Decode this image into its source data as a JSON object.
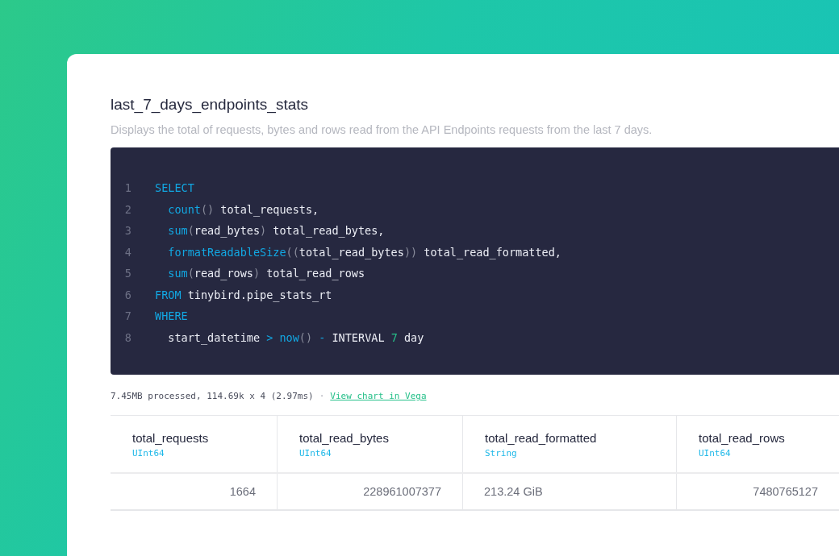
{
  "title": "last_7_days_endpoints_stats",
  "description": "Displays the total of requests, bytes and rows read from the API Endpoints requests from the last 7 days.",
  "code": [
    {
      "number": "1",
      "tokens": [
        {
          "text": "SELECT",
          "kind": "keyword"
        }
      ]
    },
    {
      "number": "2",
      "tokens": [
        {
          "text": "  count",
          "kind": "keyword"
        },
        {
          "text": "()",
          "kind": "punct"
        },
        {
          "text": " total_requests,",
          "kind": "plain"
        }
      ]
    },
    {
      "number": "3",
      "tokens": [
        {
          "text": "  sum",
          "kind": "keyword"
        },
        {
          "text": "(",
          "kind": "punct"
        },
        {
          "text": "read_bytes",
          "kind": "plain"
        },
        {
          "text": ")",
          "kind": "punct"
        },
        {
          "text": " total_read_bytes,",
          "kind": "plain"
        }
      ]
    },
    {
      "number": "4",
      "tokens": [
        {
          "text": "  formatReadableSize",
          "kind": "keyword"
        },
        {
          "text": "((",
          "kind": "punct"
        },
        {
          "text": "total_read_bytes",
          "kind": "plain"
        },
        {
          "text": "))",
          "kind": "punct"
        },
        {
          "text": " total_read_formatted,",
          "kind": "plain"
        }
      ]
    },
    {
      "number": "5",
      "tokens": [
        {
          "text": "  sum",
          "kind": "keyword"
        },
        {
          "text": "(",
          "kind": "punct"
        },
        {
          "text": "read_rows",
          "kind": "plain"
        },
        {
          "text": ")",
          "kind": "punct"
        },
        {
          "text": " total_read_rows",
          "kind": "plain"
        }
      ]
    },
    {
      "number": "6",
      "tokens": [
        {
          "text": "FROM",
          "kind": "keyword"
        },
        {
          "text": " tinybird.pipe_stats_rt",
          "kind": "plain"
        }
      ]
    },
    {
      "number": "7",
      "tokens": [
        {
          "text": "WHERE",
          "kind": "keyword"
        }
      ]
    },
    {
      "number": "8",
      "tokens": [
        {
          "text": "  start_datetime ",
          "kind": "plain"
        },
        {
          "text": ">",
          "kind": "keyword"
        },
        {
          "text": " now",
          "kind": "keyword"
        },
        {
          "text": "()",
          "kind": "punct"
        },
        {
          "text": " -",
          "kind": "keyword"
        },
        {
          "text": " INTERVAL ",
          "kind": "plain"
        },
        {
          "text": "7",
          "kind": "number"
        },
        {
          "text": " day",
          "kind": "plain"
        }
      ]
    }
  ],
  "stats": "7.45MB processed, 114.69k x 4 (2.97ms)",
  "separator": "·",
  "chart_link": "View chart in Vega",
  "table": {
    "columns": [
      {
        "name": "total_requests",
        "type": "UInt64",
        "kind": "number"
      },
      {
        "name": "total_read_bytes",
        "type": "UInt64",
        "kind": "number"
      },
      {
        "name": "total_read_formatted",
        "type": "String",
        "kind": "text"
      },
      {
        "name": "total_read_rows",
        "type": "UInt64",
        "kind": "number"
      }
    ],
    "rows": [
      [
        "1664",
        "228961007377",
        "213.24 GiB",
        "7480765127"
      ]
    ]
  }
}
